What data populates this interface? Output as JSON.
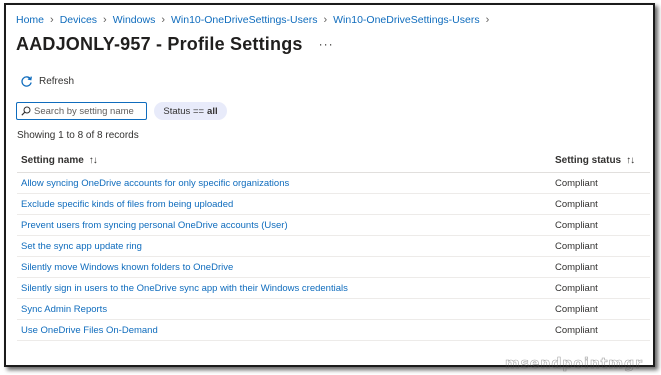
{
  "breadcrumb": [
    "Home",
    "Devices",
    "Windows",
    "Win10-OneDriveSettings-Users",
    "Win10-OneDriveSettings-Users"
  ],
  "breadcrumb_separator": "›",
  "title": "AADJONLY-957 - Profile Settings",
  "more_label": "···",
  "toolbar": {
    "refresh_label": "Refresh",
    "refresh_icon": "refresh-icon"
  },
  "search": {
    "placeholder": "Search by setting name",
    "value": ""
  },
  "filter": {
    "label": "Status ==",
    "value": "all"
  },
  "records_text": "Showing 1 to 8 of 8 records",
  "table": {
    "columns": [
      "Setting name",
      "Setting status"
    ],
    "sort_glyph": "↑↓",
    "rows": [
      {
        "name": "Allow syncing OneDrive accounts for only specific organizations",
        "status": "Compliant"
      },
      {
        "name": "Exclude specific kinds of files from being uploaded",
        "status": "Compliant"
      },
      {
        "name": "Prevent users from syncing personal OneDrive accounts (User)",
        "status": "Compliant"
      },
      {
        "name": "Set the sync app update ring",
        "status": "Compliant"
      },
      {
        "name": "Silently move Windows known folders to OneDrive",
        "status": "Compliant"
      },
      {
        "name": "Silently sign in users to the OneDrive sync app with their Windows credentials",
        "status": "Compliant"
      },
      {
        "name": "Sync Admin Reports",
        "status": "Compliant"
      },
      {
        "name": "Use OneDrive Files On-Demand",
        "status": "Compliant"
      }
    ]
  },
  "watermark": "msendpointmgr",
  "colors": {
    "link": "#0f6cbd",
    "pill_bg": "#e8ebfa",
    "text": "#323130"
  }
}
